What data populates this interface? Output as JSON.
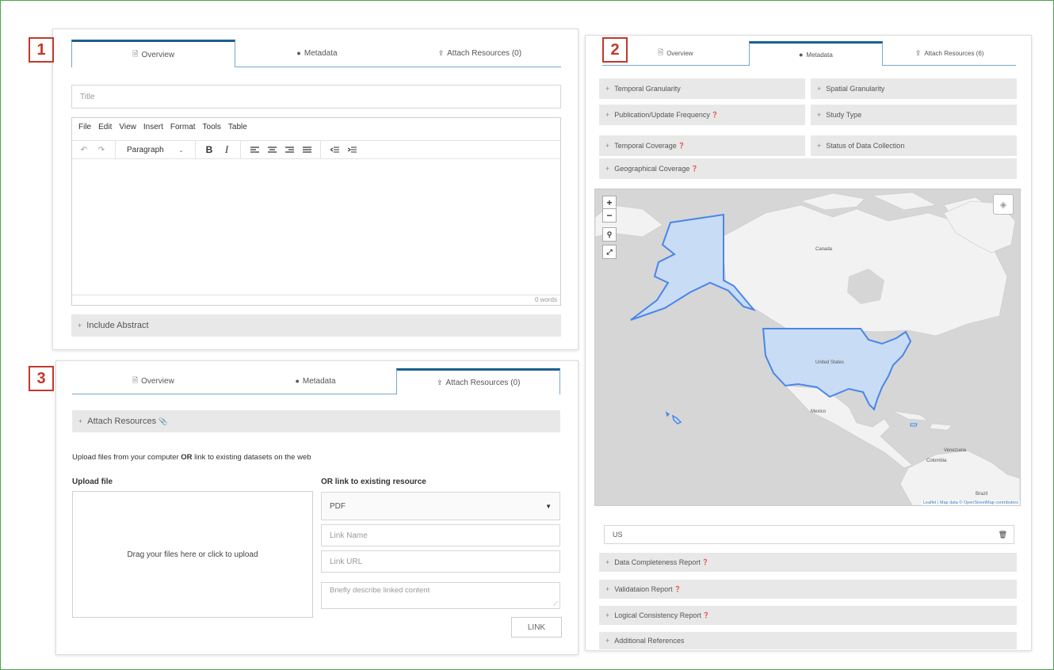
{
  "badges": {
    "one": "1",
    "two": "2",
    "three": "3"
  },
  "tabs": {
    "overview": "Overview",
    "metadata": "Metadata",
    "attach_zero": "Attach Resources (0)",
    "attach_six": "Attach Resources (6)"
  },
  "panel1": {
    "title_placeholder": "Title",
    "menu": [
      "File",
      "Edit",
      "View",
      "Insert",
      "Format",
      "Tools",
      "Table"
    ],
    "format_select": "Paragraph",
    "bold": "B",
    "italic": "I",
    "word_count": "0 words",
    "include_abstract": "Include Abstract"
  },
  "panel2": {
    "fields": {
      "temporal_granularity": "Temporal Granularity",
      "spatial_granularity": "Spatial Granularity",
      "publication_frequency": "Publication/Update Frequency",
      "study_type": "Study Type",
      "temporal_coverage": "Temporal Coverage",
      "status_data_collection": "Status of Data Collection",
      "geographical_coverage": "Geographical Coverage"
    },
    "map": {
      "zoom_in": "+",
      "zoom_out": "−",
      "labels": {
        "canada": "Canada",
        "us": "United States",
        "mexico": "Mexico",
        "venezuela": "Venezuela",
        "colombia": "Colombia",
        "brazil": "Brazil"
      },
      "attribution": "Leaflet | Map data © OpenStreetMap contributors",
      "selected_region_color": "#4a86e8"
    },
    "region_value": "US",
    "reports": {
      "completeness": "Data Completeness Report",
      "validation": "Validataion Report",
      "consistency": "Logical Consistency Report",
      "references": "Additional References"
    }
  },
  "panel3": {
    "attach_header": "Attach Resources",
    "instructions_pre": "Upload files from your computer ",
    "instructions_or": "OR",
    "instructions_post": " link to existing datasets on the web",
    "upload_label": "Upload file",
    "dropzone_text": "Drag your files here or click to upload",
    "link_label": "OR link to existing resource",
    "type_select": "PDF",
    "link_name_placeholder": "Link Name",
    "link_url_placeholder": "Link URL",
    "description_placeholder": "Briefly describe linked content",
    "link_button": "LINK"
  },
  "colors": {
    "accent": "#1d5f8f",
    "badge": "#c0392b",
    "frame": "#4aa64a"
  }
}
